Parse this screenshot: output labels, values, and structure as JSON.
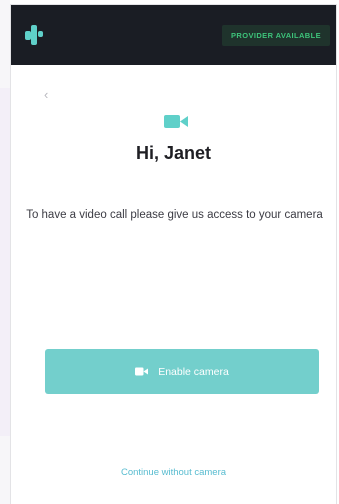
{
  "header": {
    "logo_icon": "brand-logo-icon",
    "provider_status": "PROVIDER AVAILABLE"
  },
  "main": {
    "back_icon": "chevron-left-icon",
    "camera_icon": "video-camera-icon",
    "greeting": "Hi, Janet",
    "message": "To have a video call please give us access to your camera",
    "enable_button_label": "Enable camera",
    "continue_link": "Continue without camera"
  },
  "colors": {
    "header_bg": "#1a1d24",
    "badge_text": "#3dc37a",
    "accent": "#73cfcc",
    "link": "#58bcd0"
  }
}
